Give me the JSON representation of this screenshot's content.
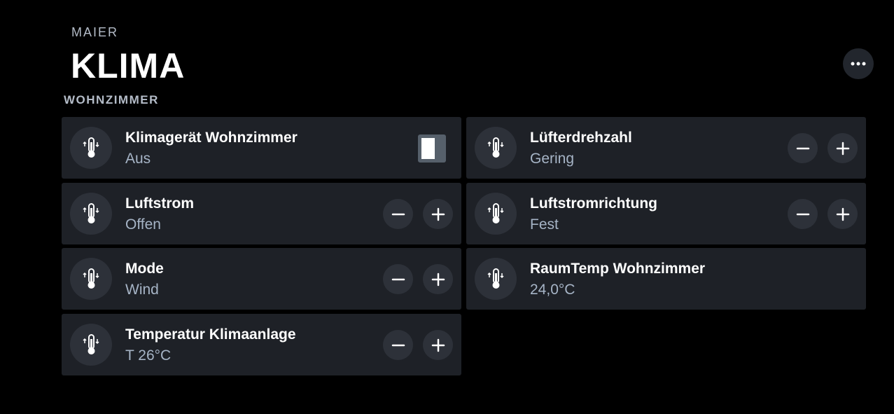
{
  "header": {
    "subtitle": "MAIER",
    "title": "KLIMA",
    "more_icon": "more-horizontal-icon"
  },
  "section": {
    "label": "WOHNZIMMER"
  },
  "cards": [
    {
      "name": "Klimagerät Wohnzimmer",
      "state": "Aus",
      "icon": "thermometer-icon",
      "control": "toggle",
      "toggle_on": false
    },
    {
      "name": "Lüfterdrehzahl",
      "state": "Gering",
      "icon": "thermometer-icon",
      "control": "stepper"
    },
    {
      "name": "Luftstrom",
      "state": "Offen",
      "icon": "thermometer-icon",
      "control": "stepper"
    },
    {
      "name": "Luftstromrichtung",
      "state": "Fest",
      "icon": "thermometer-icon",
      "control": "stepper"
    },
    {
      "name": "Mode",
      "state": "Wind",
      "icon": "thermometer-icon",
      "control": "stepper"
    },
    {
      "name": "RaumTemp Wohnzimmer",
      "state": "24,0°C",
      "icon": "thermometer-icon",
      "control": "none"
    },
    {
      "name": "Temperatur Klimaanlage",
      "state": "T 26°C",
      "icon": "thermometer-icon",
      "control": "stepper"
    }
  ],
  "colors": {
    "background": "#000000",
    "card": "#1e2127",
    "button": "#2d3139",
    "state_text": "#a6b4c6"
  }
}
